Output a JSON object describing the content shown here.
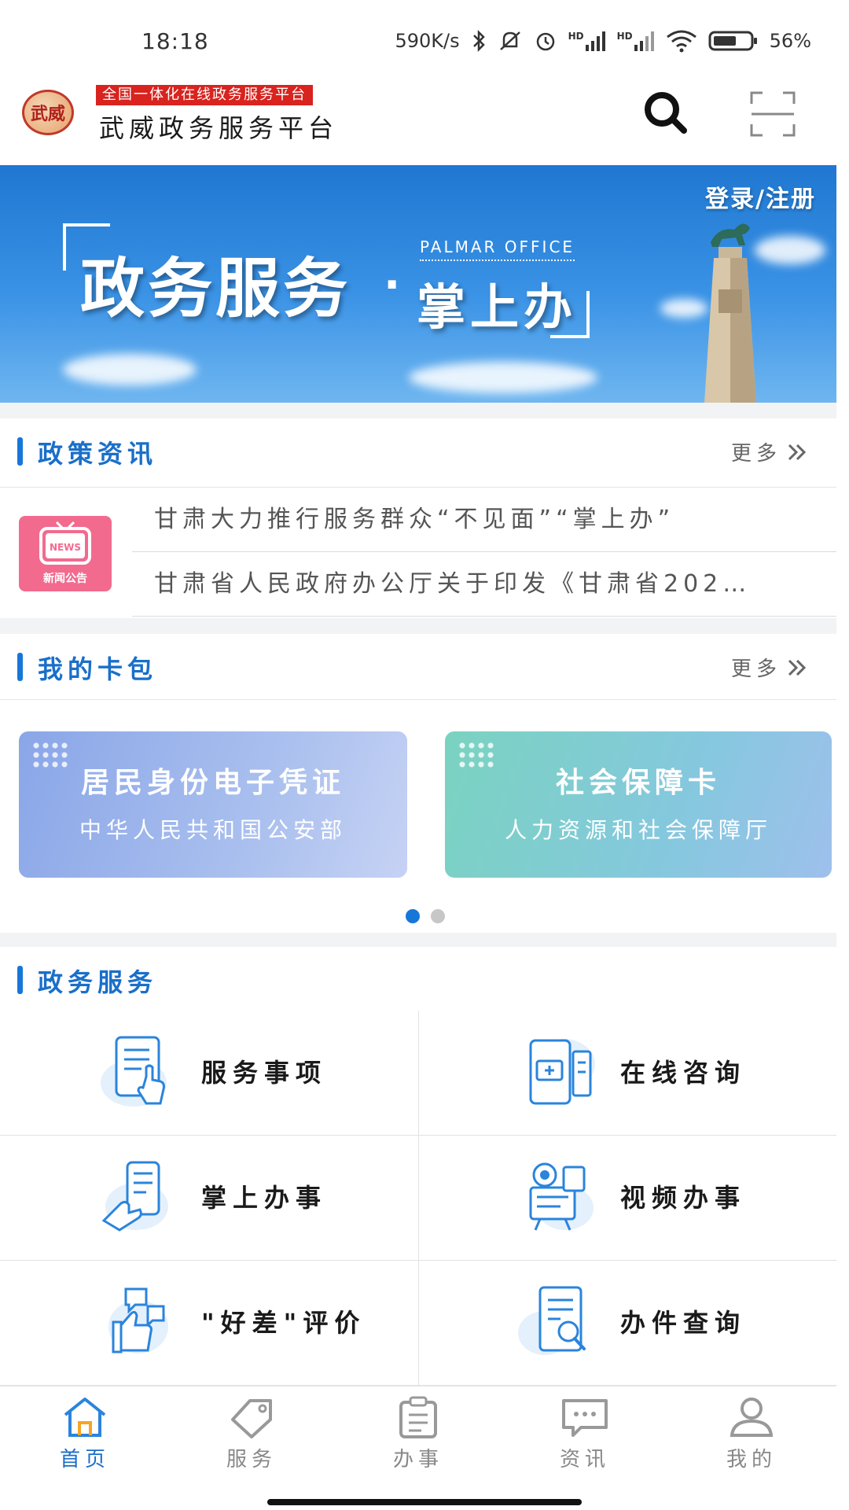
{
  "status_bar": {
    "time": "18:18",
    "net_speed": "590K/s",
    "signal1_label": "HD",
    "signal2_label": "HD",
    "battery": "56%"
  },
  "header": {
    "logo_text": "武威",
    "subtitle": "全国一体化在线政务服务平台",
    "title": "武威政务服务平台",
    "icons": [
      "search-icon",
      "scan-icon"
    ]
  },
  "banner": {
    "main": "政务服务",
    "dot": "·",
    "en": "PALMAR OFFICE",
    "sub": "掌上办",
    "login": "登录/注册"
  },
  "policy": {
    "title": "政策资讯",
    "more": "更多",
    "icon_badge": "NEWS",
    "icon_caption": "新闻公告",
    "items": [
      "甘肃大力推行服务群众“不见面”“掌上办”",
      "甘肃省人民政府办公厅关于印发《甘肃省202…"
    ]
  },
  "wallet": {
    "title": "我的卡包",
    "more": "更多",
    "cards": [
      {
        "title": "居民身份电子凭证",
        "sub": "中华人民共和国公安部"
      },
      {
        "title": "社会保障卡",
        "sub": "人力资源和社会保障厅"
      }
    ]
  },
  "services": {
    "title": "政务服务",
    "items": [
      {
        "label": "服务事项",
        "icon": "tablet-touch-icon"
      },
      {
        "label": "在线咨询",
        "icon": "online-consult-icon"
      },
      {
        "label": "掌上办事",
        "icon": "phone-hand-icon"
      },
      {
        "label": "视频办事",
        "icon": "video-service-icon"
      },
      {
        "label": "\"好差\"评价",
        "icon": "thumbs-up-rating-icon"
      },
      {
        "label": "办件查询",
        "icon": "document-search-icon"
      }
    ]
  },
  "nav": {
    "items": [
      {
        "label": "首页",
        "icon": "home-icon",
        "active": true
      },
      {
        "label": "服务",
        "icon": "tag-icon"
      },
      {
        "label": "办事",
        "icon": "clipboard-icon"
      },
      {
        "label": "资讯",
        "icon": "chat-icon"
      },
      {
        "label": "我的",
        "icon": "user-icon"
      }
    ]
  },
  "colors": {
    "accent": "#1677d8",
    "brand_red": "#d8231e",
    "banner_blue": "#2a84dc"
  }
}
